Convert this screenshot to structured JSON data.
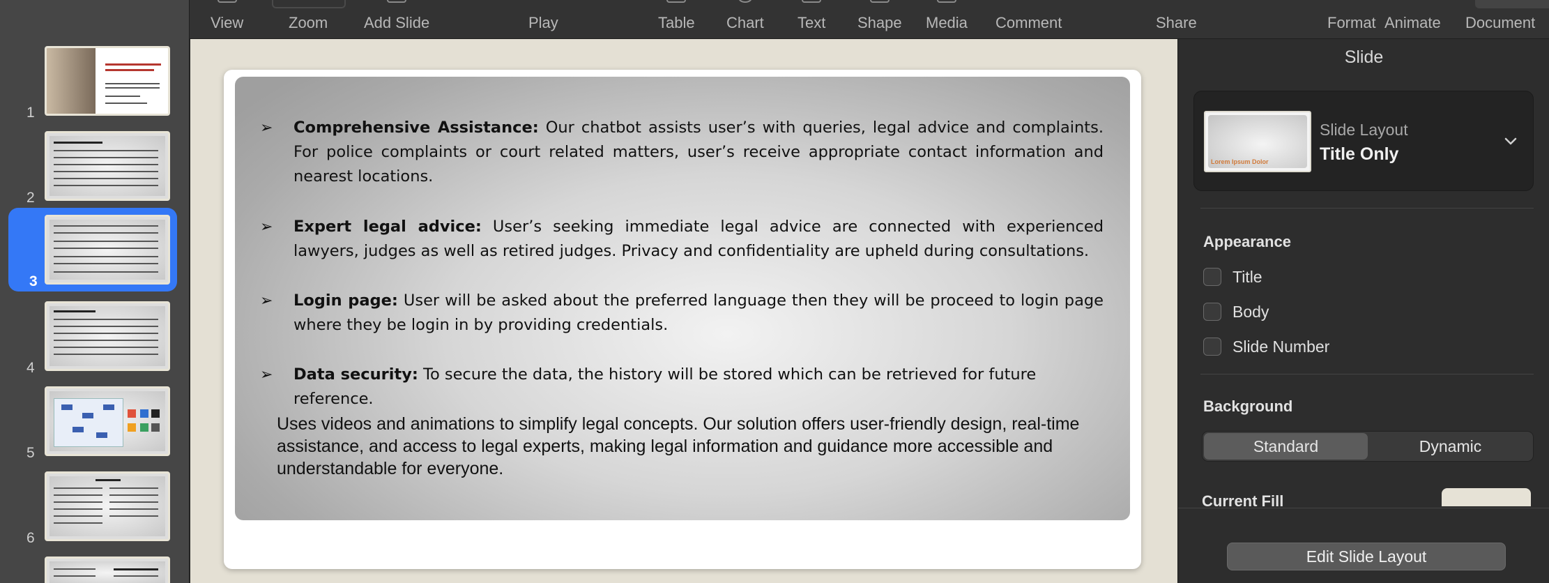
{
  "toolbar": {
    "view": "View",
    "zoom": "Zoom",
    "add_slide": "Add Slide",
    "play": "Play",
    "table": "Table",
    "chart": "Chart",
    "text": "Text",
    "shape": "Shape",
    "media": "Media",
    "comment": "Comment",
    "share": "Share",
    "format": "Format",
    "animate": "Animate",
    "document": "Document"
  },
  "navigator": {
    "slides": [
      {
        "number": "1"
      },
      {
        "number": "2"
      },
      {
        "number": "3",
        "selected": true
      },
      {
        "number": "4"
      },
      {
        "number": "5"
      },
      {
        "number": "6"
      },
      {
        "number": ""
      }
    ],
    "selected_color": "#3478f6"
  },
  "slide": {
    "bullets": [
      {
        "arrow": "➢",
        "bold": "Comprehensive Assistance:",
        "text": " Our chatbot assists user’s with queries, legal advice and complaints. For police complaints or court related matters, user’s receive appropriate contact information and nearest locations."
      },
      {
        "arrow": "➢",
        "bold": "Expert legal advice:",
        "text": " User’s seeking immediate legal advice are connected with experienced lawyers, judges as well as retired judges. Privacy and confidentiality are upheld during consultations."
      },
      {
        "arrow": "➢",
        "bold": "Login page:",
        "text": " User will be asked about the preferred language then they will be proceed to login page where they be login in by providing credentials."
      },
      {
        "arrow": "➢",
        "bold": "Data security:",
        "text": " To secure the data, the history will be stored which can be retrieved for future reference."
      }
    ],
    "paragraph": "Uses videos and animations to simplify legal concepts. Our solution offers user-friendly design, real-time assistance, and access to legal experts, making legal information and guidance more accessible and understandable for everyone."
  },
  "inspector": {
    "title": "Slide",
    "slide_layout_label": "Slide Layout",
    "slide_layout_value": "Title Only",
    "layout_thumb_text": "Lorem Ipsum Dolor",
    "appearance_label": "Appearance",
    "checkboxes": {
      "title": "Title",
      "body": "Body",
      "slide_number": "Slide Number"
    },
    "background_label": "Background",
    "segments": {
      "standard": "Standard",
      "dynamic": "Dynamic"
    },
    "current_fill_label": "Current Fill",
    "current_fill_color": "#e6e2d6",
    "edit_layout_button": "Edit Slide Layout"
  }
}
